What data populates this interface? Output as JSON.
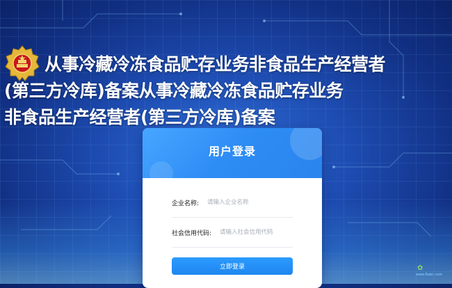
{
  "header": {
    "title_line1": "从事冷藏冷冻食品贮存业务非食品生产经营者",
    "title_line2": "(第三方冷库)备案从事冷藏冷冻食品贮存业务",
    "title_line3": "非食品生产经营者(第三方冷库)备案",
    "emblem_icon": "police-emblem-icon"
  },
  "login": {
    "title": "用户登录",
    "company_label": "企业名称:",
    "company_placeholder": "请输入企业名称",
    "company_value": "",
    "credit_label": "社会信用代码:",
    "credit_placeholder": "请输入社会信用代码",
    "credit_value": "",
    "submit_label": "立即登录"
  },
  "watermark": {
    "text": "www.ftabc.com"
  },
  "colors": {
    "background": "#1d4bb0",
    "card_header": "#2d8cf5",
    "button": "#1f86f0",
    "title_text": "#ffffff"
  }
}
